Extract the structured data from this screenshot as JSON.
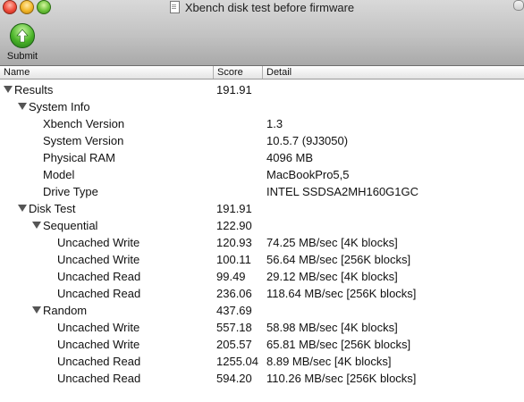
{
  "window": {
    "title": "Xbench disk test before firmware"
  },
  "toolbar": {
    "submit_label": "Submit"
  },
  "columns": {
    "name": "Name",
    "score": "Score",
    "detail": "Detail"
  },
  "rows": [
    {
      "name": "Results",
      "score": "191.91",
      "detail": "",
      "level": 0,
      "disclosure": true
    },
    {
      "name": "System Info",
      "score": "",
      "detail": "",
      "level": 1,
      "disclosure": true
    },
    {
      "name": "Xbench Version",
      "score": "",
      "detail": "1.3",
      "level": 2,
      "disclosure": false
    },
    {
      "name": "System Version",
      "score": "",
      "detail": "10.5.7 (9J3050)",
      "level": 2,
      "disclosure": false
    },
    {
      "name": "Physical RAM",
      "score": "",
      "detail": "4096 MB",
      "level": 2,
      "disclosure": false
    },
    {
      "name": "Model",
      "score": "",
      "detail": "MacBookPro5,5",
      "level": 2,
      "disclosure": false
    },
    {
      "name": "Drive Type",
      "score": "",
      "detail": "INTEL SSDSA2MH160G1GC",
      "level": 2,
      "disclosure": false
    },
    {
      "name": "Disk Test",
      "score": "191.91",
      "detail": "",
      "level": 1,
      "disclosure": true
    },
    {
      "name": "Sequential",
      "score": "122.90",
      "detail": "",
      "level": 2,
      "disclosure": true
    },
    {
      "name": "Uncached Write",
      "score": "120.93",
      "detail": "74.25 MB/sec [4K blocks]",
      "level": 3,
      "disclosure": false
    },
    {
      "name": "Uncached Write",
      "score": "100.11",
      "detail": "56.64 MB/sec [256K blocks]",
      "level": 3,
      "disclosure": false
    },
    {
      "name": "Uncached Read",
      "score": "99.49",
      "detail": "29.12 MB/sec [4K blocks]",
      "level": 3,
      "disclosure": false
    },
    {
      "name": "Uncached Read",
      "score": "236.06",
      "detail": "118.64 MB/sec [256K blocks]",
      "level": 3,
      "disclosure": false
    },
    {
      "name": "Random",
      "score": "437.69",
      "detail": "",
      "level": 2,
      "disclosure": true
    },
    {
      "name": "Uncached Write",
      "score": "557.18",
      "detail": "58.98 MB/sec [4K blocks]",
      "level": 3,
      "disclosure": false
    },
    {
      "name": "Uncached Write",
      "score": "205.57",
      "detail": "65.81 MB/sec [256K blocks]",
      "level": 3,
      "disclosure": false
    },
    {
      "name": "Uncached Read",
      "score": "1255.04",
      "detail": "8.89 MB/sec [4K blocks]",
      "level": 3,
      "disclosure": false
    },
    {
      "name": "Uncached Read",
      "score": "594.20",
      "detail": "110.26 MB/sec [256K blocks]",
      "level": 3,
      "disclosure": false
    }
  ]
}
